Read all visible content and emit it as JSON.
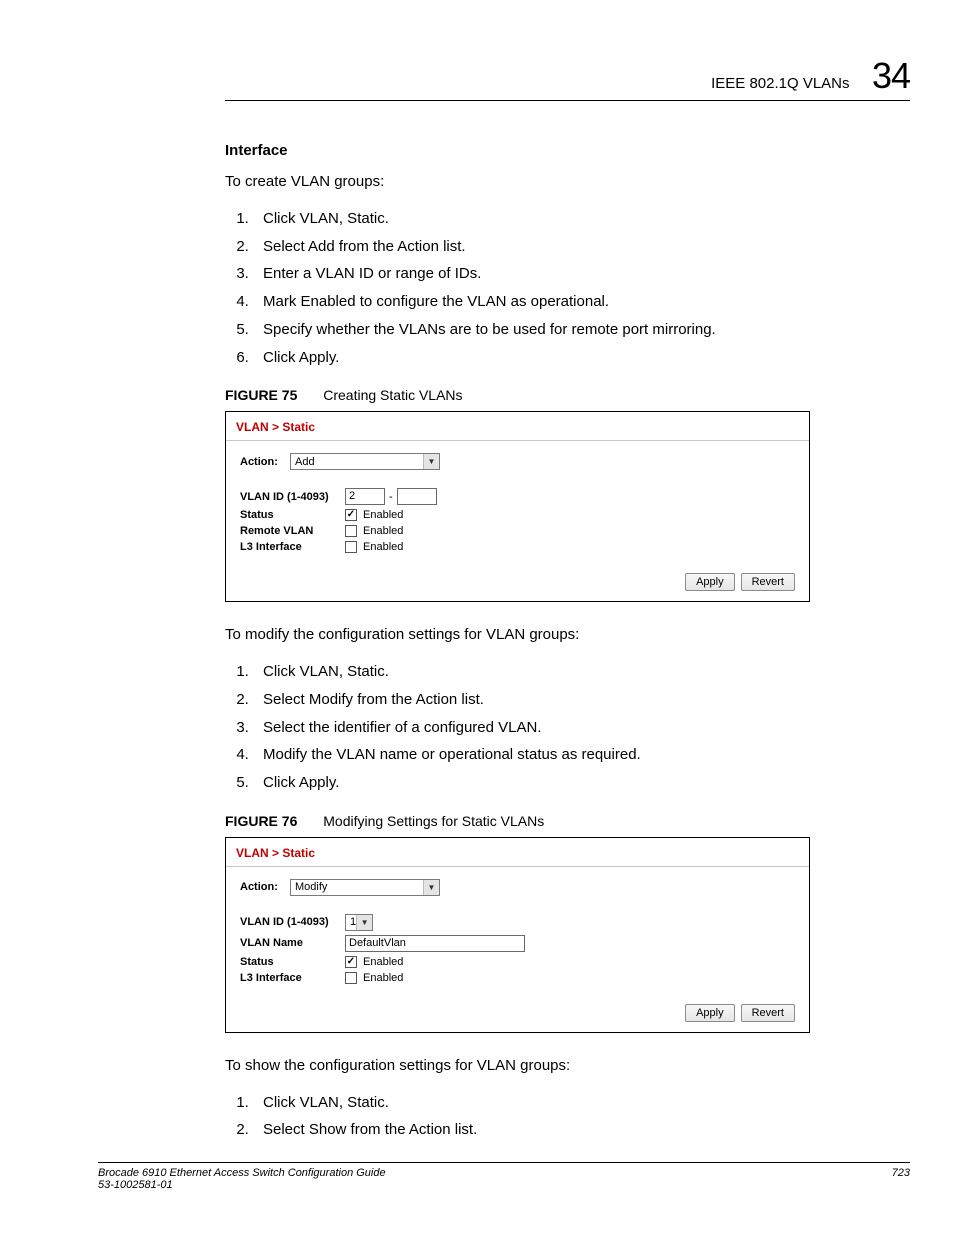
{
  "header": {
    "section": "IEEE 802.1Q VLANs",
    "chapter": "34"
  },
  "interface_heading": "Interface",
  "intro1": "To create VLAN groups:",
  "steps1": [
    "Click VLAN, Static.",
    "Select Add from the Action list.",
    "Enter a VLAN ID or range of IDs.",
    "Mark Enabled to configure the VLAN as operational.",
    "Specify whether the VLANs are to be used for remote port mirroring.",
    "Click Apply."
  ],
  "fig75": {
    "label": "FIGURE 75",
    "caption": "Creating Static VLANs"
  },
  "shot1": {
    "crumb": "VLAN > Static",
    "action_label": "Action:",
    "action_value": "Add",
    "vlanid_label": "VLAN ID (1-4093)",
    "vlanid_value": "2",
    "vlanid_dash": "-",
    "status_label": "Status",
    "status_text": "Enabled",
    "remote_label": "Remote VLAN",
    "remote_text": "Enabled",
    "l3_label": "L3 Interface",
    "l3_text": "Enabled",
    "apply": "Apply",
    "revert": "Revert"
  },
  "intro2": "To modify the configuration settings for VLAN groups:",
  "steps2": [
    "Click VLAN, Static.",
    "Select Modify from the Action list.",
    "Select the identifier of a configured VLAN.",
    "Modify the VLAN name or operational status as required.",
    "Click Apply."
  ],
  "fig76": {
    "label": "FIGURE 76",
    "caption": "Modifying Settings for Static VLANs"
  },
  "shot2": {
    "crumb": "VLAN > Static",
    "action_label": "Action:",
    "action_value": "Modify",
    "vlanid_label": "VLAN ID (1-4093)",
    "vlanid_value": "1",
    "vlanname_label": "VLAN Name",
    "vlanname_value": "DefaultVlan",
    "status_label": "Status",
    "status_text": "Enabled",
    "l3_label": "L3 Interface",
    "l3_text": "Enabled",
    "apply": "Apply",
    "revert": "Revert"
  },
  "intro3": "To show the configuration settings for VLAN groups:",
  "steps3": [
    "Click VLAN, Static.",
    "Select Show from the Action list."
  ],
  "footer": {
    "title": "Brocade 6910 Ethernet Access Switch Configuration Guide",
    "docnum": "53-1002581-01",
    "page": "723"
  }
}
